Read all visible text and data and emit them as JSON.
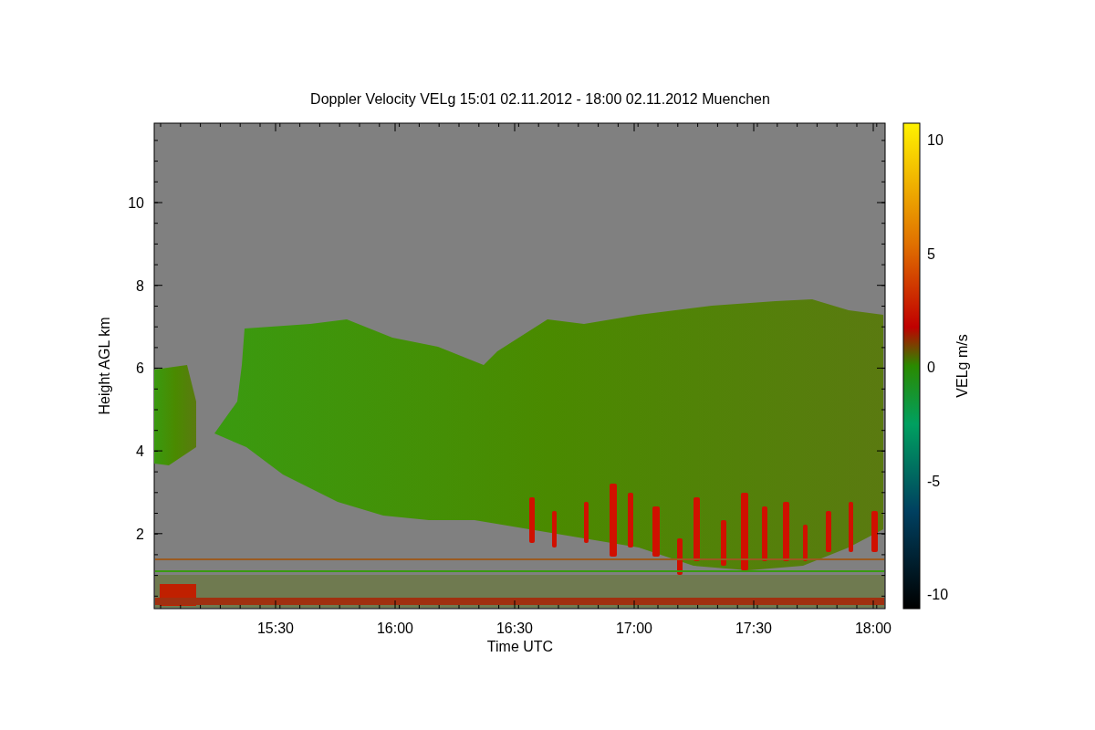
{
  "figure": {
    "title": "Doppler Velocity VELg   15:01 02.11.2012 - 18:00 02.11.2012 Muenchen",
    "xlabel": "Time UTC",
    "ylabel": "Height AGL km",
    "xtick_labels": [
      "15:30",
      "16:00",
      "16:30",
      "17:00",
      "17:30",
      "18:00"
    ],
    "ytick_labels": [
      "10",
      "8",
      "6",
      "4",
      "2"
    ],
    "colorbar": {
      "label": "VELg m/s",
      "tick_labels": [
        "10",
        "5",
        "0",
        "-5",
        "-10"
      ]
    }
  }
}
